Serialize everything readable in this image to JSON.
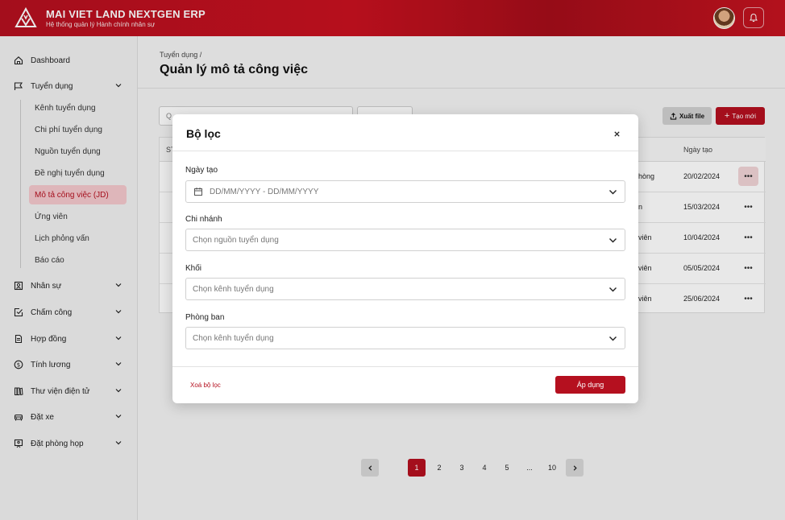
{
  "header": {
    "brand_title": "MAI VIET LAND NEXTGEN ERP",
    "brand_subtitle": "Hệ thống quản lý Hành chính nhân sự"
  },
  "sidebar": {
    "items": [
      {
        "label": "Dashboard",
        "icon": "home-icon"
      },
      {
        "label": "Tuyển dụng",
        "icon": "flag-icon"
      },
      {
        "label": "Nhân sự",
        "icon": "person-card-icon"
      },
      {
        "label": "Chấm công",
        "icon": "checkbox-icon"
      },
      {
        "label": "Hợp đồng",
        "icon": "document-icon"
      },
      {
        "label": "Tính lương",
        "icon": "dollar-icon"
      },
      {
        "label": "Thư viện điện tử",
        "icon": "books-icon"
      },
      {
        "label": "Đặt xe",
        "icon": "car-icon"
      },
      {
        "label": "Đặt phòng họp",
        "icon": "meeting-icon"
      }
    ],
    "sub_items": [
      "Kênh tuyển dụng",
      "Chi phí tuyển dụng",
      "Nguồn tuyển dụng",
      "Đề nghị tuyển dụng",
      "Mô tả công việc (JD)",
      "Ứng viên",
      "Lịch phỏng vấn",
      "Báo cáo"
    ]
  },
  "main": {
    "breadcrumb": "Tuyển dụng /",
    "title": "Quản lý mô tả công việc",
    "export_label": "Xuất file",
    "new_label": "Tạo mới",
    "search_placeholder": "Q",
    "table": {
      "header_stt": "ST",
      "header_date": "Ngày tạo",
      "rows": [
        {
          "pos": "hòng",
          "date": "20/02/2024"
        },
        {
          "pos": "n",
          "date": "15/03/2024"
        },
        {
          "pos": "viên",
          "date": "10/04/2024"
        },
        {
          "pos": "viên",
          "date": "05/05/2024"
        },
        {
          "pos": "viên",
          "date": "25/06/2024"
        }
      ]
    },
    "pagination": [
      "1",
      "2",
      "3",
      "4",
      "5",
      "...",
      "10"
    ]
  },
  "modal": {
    "title": "Bộ lọc",
    "fields": [
      {
        "label": "Ngày tạo",
        "placeholder": "DD/MM/YYYY - DD/MM/YYYY"
      },
      {
        "label": "Chi nhánh",
        "placeholder": "Chọn nguồn tuyển dụng"
      },
      {
        "label": "Khối",
        "placeholder": "Chọn kênh tuyển dụng"
      },
      {
        "label": "Phòng ban",
        "placeholder": "Chọn kênh tuyển dụng"
      }
    ],
    "clear_label": "Xoá bộ lọc",
    "apply_label": "Áp dụng"
  },
  "colors": {
    "brand": "#b5101f",
    "active_bg": "#f5c9cd"
  }
}
